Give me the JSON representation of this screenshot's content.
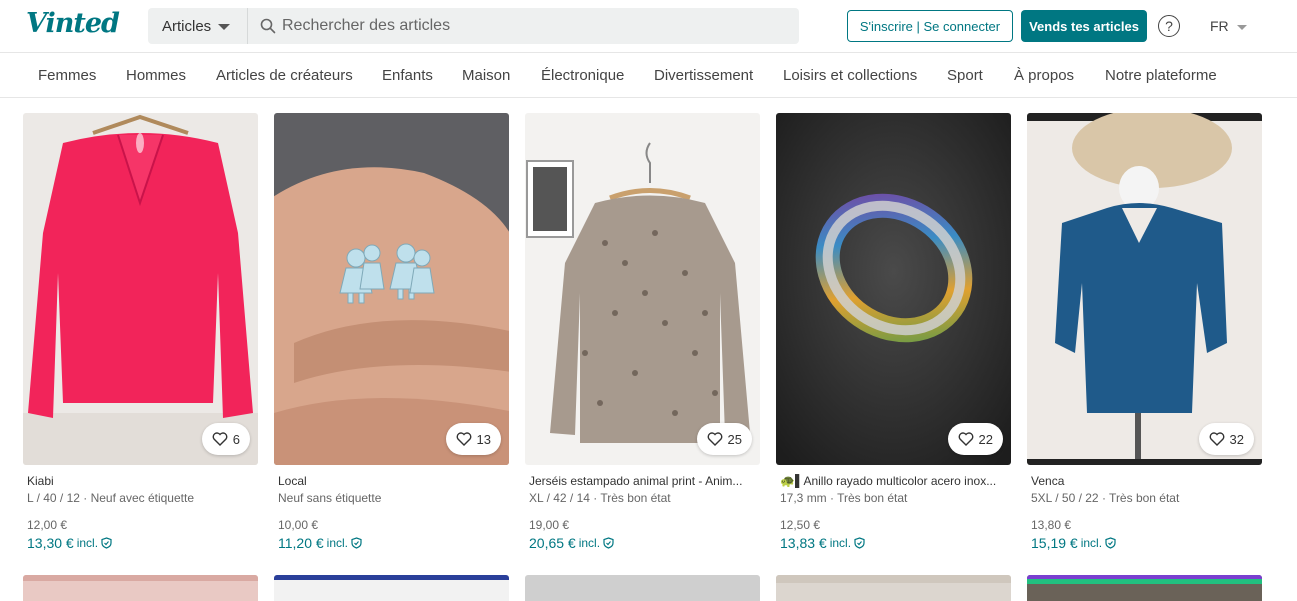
{
  "header": {
    "logo": "Vinted",
    "search_category": "Articles",
    "search_placeholder": "Rechercher des articles",
    "login_label": "S'inscrire | Se connecter",
    "sell_label": "Vends tes articles",
    "help_label": "?",
    "language": "FR"
  },
  "nav": {
    "items": [
      "Femmes",
      "Hommes",
      "Articles de créateurs",
      "Enfants",
      "Maison",
      "Électronique",
      "Divertissement",
      "Loisirs et collections",
      "Sport",
      "À propos",
      "Notre plateforme"
    ]
  },
  "items": [
    {
      "brand": "Kiabi",
      "details": "L / 40 / 12 · Neuf avec étiquette",
      "price": "12,00 €",
      "price_incl": "13,30 €",
      "incl_label": "incl.",
      "favorites": "6"
    },
    {
      "brand": "Local",
      "details": "Neuf sans étiquette",
      "price": "10,00 €",
      "price_incl": "11,20 €",
      "incl_label": "incl.",
      "favorites": "13"
    },
    {
      "brand": "Jerséis estampado animal print - Anim...",
      "details": "XL / 42 / 14 · Très bon état",
      "price": "19,00 €",
      "price_incl": "20,65 €",
      "incl_label": "incl.",
      "favorites": "25"
    },
    {
      "brand": "🐢▌Anillo rayado multicolor acero inox...",
      "details": "17,3 mm · Très bon état",
      "price": "12,50 €",
      "price_incl": "13,83 €",
      "incl_label": "incl.",
      "favorites": "22"
    },
    {
      "brand": "Venca",
      "details": "5XL / 50 / 22 · Très bon état",
      "price": "13,80 €",
      "price_incl": "15,19 €",
      "incl_label": "incl.",
      "favorites": "32"
    }
  ],
  "colors": {
    "brand": "#007782",
    "nav_text": "#444444",
    "muted": "#666666"
  }
}
